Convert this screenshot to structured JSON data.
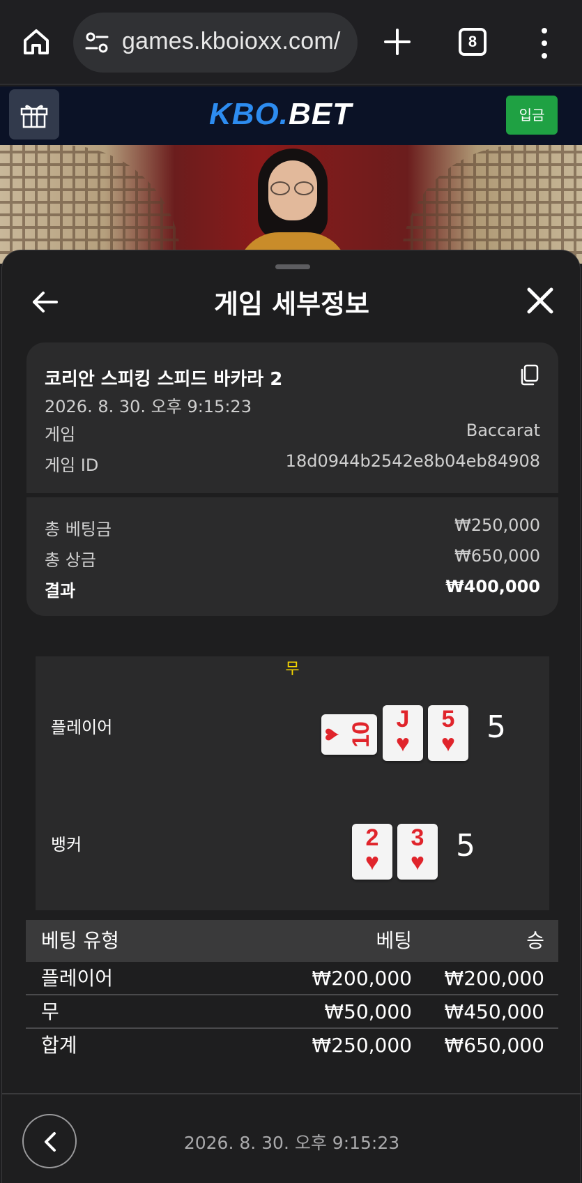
{
  "browser": {
    "url": "games.kboioxx.com/",
    "tab_count": "8"
  },
  "site": {
    "logo_kbo": "KBO.",
    "logo_bet": "BET",
    "deposit_label": "입금"
  },
  "sheet": {
    "title": "게임 세부정보"
  },
  "game": {
    "name": "코리안 스피킹 스피드 바카라 2",
    "datetime": "2026. 8. 30. 오후 9:15:23",
    "type_label": "게임",
    "type_value": "Baccarat",
    "id_label": "게임 ID",
    "id_value": "18d0944b2542e8b04eb84908",
    "total_bet_label": "총 베팅금",
    "total_bet_value": "₩250,000",
    "total_prize_label": "총 상금",
    "total_prize_value": "₩650,000",
    "result_label": "결과",
    "result_value": "₩400,000"
  },
  "board": {
    "winner_label": "무",
    "player_label": "플레이어",
    "player_score": "5",
    "player_cards": [
      {
        "rank": "10",
        "suit": "♥",
        "orientation": "side"
      },
      {
        "rank": "J",
        "suit": "♥",
        "orientation": "up"
      },
      {
        "rank": "5",
        "suit": "♥",
        "orientation": "up"
      }
    ],
    "banker_label": "뱅커",
    "banker_score": "5",
    "banker_cards": [
      {
        "rank": "2",
        "suit": "♥",
        "orientation": "up"
      },
      {
        "rank": "3",
        "suit": "♥",
        "orientation": "up"
      }
    ]
  },
  "bets": {
    "headers": {
      "type": "베팅 유형",
      "bet": "베팅",
      "win": "승"
    },
    "rows": [
      {
        "type": "플레이어",
        "bet": "₩200,000",
        "win": "₩200,000"
      },
      {
        "type": "무",
        "bet": "₩50,000",
        "win": "₩450,000"
      },
      {
        "type": "합계",
        "bet": "₩250,000",
        "win": "₩650,000"
      }
    ]
  },
  "footer": {
    "datetime": "2026. 8. 30. 오후 9:15:23"
  },
  "colors": {
    "winner": "#f5d600",
    "deposit": "#1fa143",
    "logo_blue": "#2d8cf0",
    "card_red": "#e0242b"
  },
  "icons": [
    "home-icon",
    "tune-icon",
    "plus-icon",
    "tabs-icon",
    "more-vert-icon",
    "gift-icon",
    "back-arrow-icon",
    "close-icon",
    "copy-icon",
    "chevron-left-icon",
    "heart-suit-icon"
  ]
}
